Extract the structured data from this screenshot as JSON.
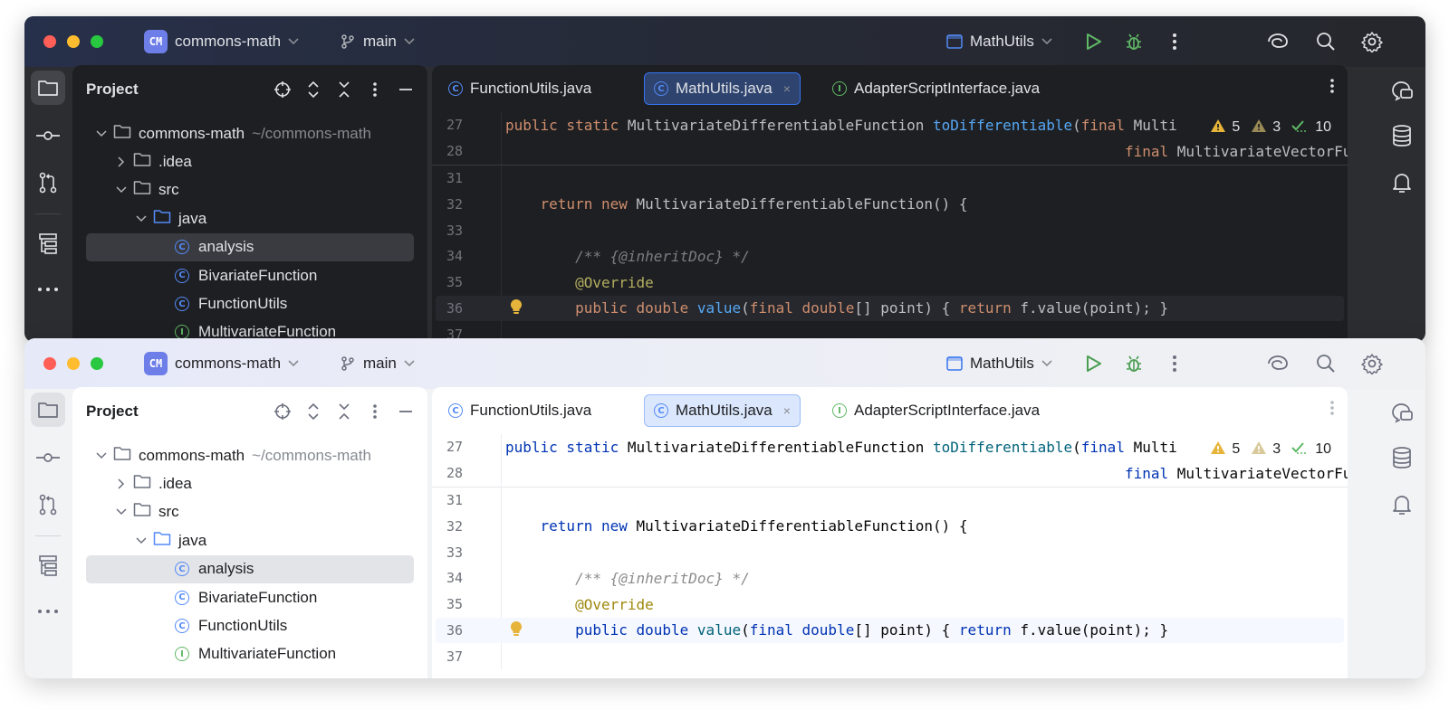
{
  "project": {
    "badge": "CM",
    "name": "commons-math"
  },
  "branch": "main",
  "run_config": "MathUtils",
  "panel": {
    "title": "Project",
    "tree": [
      {
        "label": "commons-math",
        "hint": "~/commons-math",
        "icon": "folder-icon",
        "expand": "open"
      },
      {
        "label": ".idea",
        "hint": "",
        "icon": "folder-icon",
        "expand": "closed"
      },
      {
        "label": "src",
        "hint": "",
        "icon": "folder-icon",
        "expand": "open"
      },
      {
        "label": "java",
        "hint": "",
        "icon": "source-folder-icon",
        "expand": "open"
      },
      {
        "label": "analysis",
        "hint": "",
        "icon": "class-icon",
        "expand": "none",
        "selected": true
      },
      {
        "label": "BivariateFunction",
        "hint": "",
        "icon": "class-icon",
        "expand": "none"
      },
      {
        "label": "FunctionUtils",
        "hint": "",
        "icon": "class-icon",
        "expand": "none"
      },
      {
        "label": "MultivariateFunction",
        "hint": "",
        "icon": "interface-icon",
        "expand": "none"
      }
    ]
  },
  "tabs": [
    {
      "label": "FunctionUtils.java",
      "icon": "class-icon",
      "active": false
    },
    {
      "label": "MathUtils.java",
      "icon": "class-icon",
      "active": true,
      "close": "×"
    },
    {
      "label": "AdapterScriptInterface.java",
      "icon": "interface-icon",
      "active": false
    }
  ],
  "inspections": {
    "warnings": "5",
    "weak_warnings": "3",
    "ok": "10"
  },
  "code": {
    "sticky": [
      {
        "num": "27",
        "segments": [
          [
            "kw",
            "public static "
          ],
          [
            "",
            "MultivariateDifferentiableFunction "
          ],
          [
            "fn",
            "toDifferentiable"
          ],
          [
            "",
            "("
          ],
          [
            "kw",
            "final "
          ],
          [
            "",
            "Multi"
          ]
        ]
      },
      {
        "num": "28",
        "segments": [
          [
            "",
            "                                                                       "
          ],
          [
            "kw",
            "final "
          ],
          [
            "",
            "MultivariateVectorFu"
          ]
        ]
      }
    ],
    "lines": [
      {
        "num": "31",
        "segments": []
      },
      {
        "num": "32",
        "segments": [
          [
            "",
            "    "
          ],
          [
            "kw",
            "return new "
          ],
          [
            "",
            "MultivariateDifferentiableFunction() {"
          ]
        ]
      },
      {
        "num": "33",
        "segments": []
      },
      {
        "num": "34",
        "segments": [
          [
            "",
            "        "
          ],
          [
            "cm2",
            "/** {@inheritDoc} */"
          ]
        ]
      },
      {
        "num": "35",
        "segments": [
          [
            "",
            "        "
          ],
          [
            "an",
            "@Override"
          ]
        ]
      },
      {
        "num": "36",
        "segments": [
          [
            "",
            "        "
          ],
          [
            "kw",
            "public double "
          ],
          [
            "fn",
            "value"
          ],
          [
            "",
            "("
          ],
          [
            "kw",
            "final double"
          ],
          [
            "",
            "[] point) { "
          ],
          [
            "kw",
            "return "
          ],
          [
            "",
            "f.value(point); }"
          ]
        ],
        "current": true,
        "bulb": true
      },
      {
        "num": "37",
        "segments": []
      }
    ]
  },
  "colors": {
    "accent": "#3574f0",
    "run": "#5fb865",
    "debug": "#5fb865",
    "warning": "#e6b43a"
  }
}
